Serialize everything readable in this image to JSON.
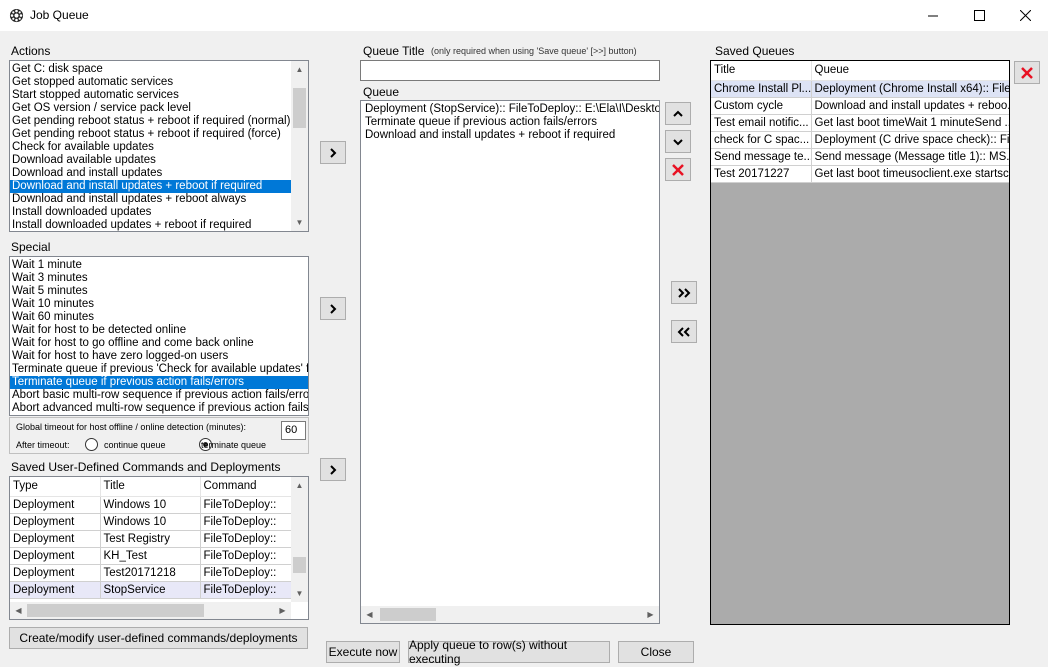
{
  "window": {
    "title": "Job Queue"
  },
  "actions": {
    "label": "Actions",
    "items": [
      "Get C: disk space",
      "Get stopped automatic services",
      "Start stopped automatic services",
      "Get OS version / service pack level",
      "Get pending reboot status + reboot if required (normal)",
      "Get pending reboot status + reboot if required (force)",
      "Check for available updates",
      "Download available updates",
      "Download and install updates",
      "Download and install updates + reboot if required",
      "Download and install updates + reboot always",
      "Install downloaded updates",
      "Install downloaded updates + reboot if required"
    ],
    "selected_index": 9
  },
  "special": {
    "label": "Special",
    "items": [
      "Wait 1 minute",
      "Wait 3 minutes",
      "Wait 5 minutes",
      "Wait 10 minutes",
      "Wait 60 minutes",
      "Wait for host to be detected online",
      "Wait for host to go offline and come back online",
      "Wait for host to have zero logged-on users",
      "Terminate queue if previous 'Check for available updates' finds",
      "Terminate queue if previous action fails/errors",
      "Abort basic multi-row sequence if previous action fails/errors",
      "Abort advanced multi-row sequence if previous action fails/erro"
    ],
    "selected_index": 9
  },
  "timeout": {
    "label": "Global timeout for host offline / online detection (minutes):",
    "value": "60",
    "after_label": "After timeout:",
    "option_continue": "continue queue",
    "option_terminate": "terminate queue",
    "selected": "terminate queue"
  },
  "saved_commands": {
    "label": "Saved User-Defined Commands and Deployments",
    "columns": [
      "Type",
      "Title",
      "Command"
    ],
    "rows": [
      [
        "Deployment",
        "Windows 10",
        "FileToDeploy::"
      ],
      [
        "Deployment",
        "Windows 10",
        "FileToDeploy::"
      ],
      [
        "Deployment",
        "Test Registry",
        "FileToDeploy::"
      ],
      [
        "Deployment",
        "KH_Test",
        "FileToDeploy::"
      ],
      [
        "Deployment",
        "Test20171218",
        "FileToDeploy::"
      ],
      [
        "Deployment",
        "StopService",
        "FileToDeploy::"
      ]
    ],
    "selected_index": 5
  },
  "create_button": "Create/modify user-defined commands/deployments",
  "queue_title": {
    "label": "Queue Title",
    "note": "(only required when using 'Save queue' [>>] button)",
    "value": ""
  },
  "queue": {
    "label": "Queue",
    "items": [
      "Deployment (StopService):: FileToDeploy:: E:\\Ela\\I\\Desktop\\S",
      "Terminate queue if previous action fails/errors",
      "Download and install updates + reboot if required"
    ]
  },
  "saved_queues": {
    "label": "Saved Queues",
    "columns": [
      "Title",
      "Queue"
    ],
    "rows": [
      [
        "Chrome Install Pl...",
        "Deployment (Chrome Install x64):: File..."
      ],
      [
        "Custom cycle",
        "Download and install updates + reboo..."
      ],
      [
        "Test email notific...",
        "Get last boot timeWait 1 minuteSend ..."
      ],
      [
        "check for C spac...",
        "Deployment (C drive space check):: Fi..."
      ],
      [
        "Send message te...",
        "Send message (Message title 1):: MS..."
      ],
      [
        "Test 20171227",
        "Get last boot timeusoclient.exe startsc..."
      ]
    ],
    "selected_index": 0
  },
  "bottom_buttons": {
    "execute": "Execute now",
    "apply": "Apply queue to row(s) without executing",
    "close": "Close"
  },
  "colors": {
    "selection": "#0078d7",
    "delete_red": "#e81123"
  }
}
